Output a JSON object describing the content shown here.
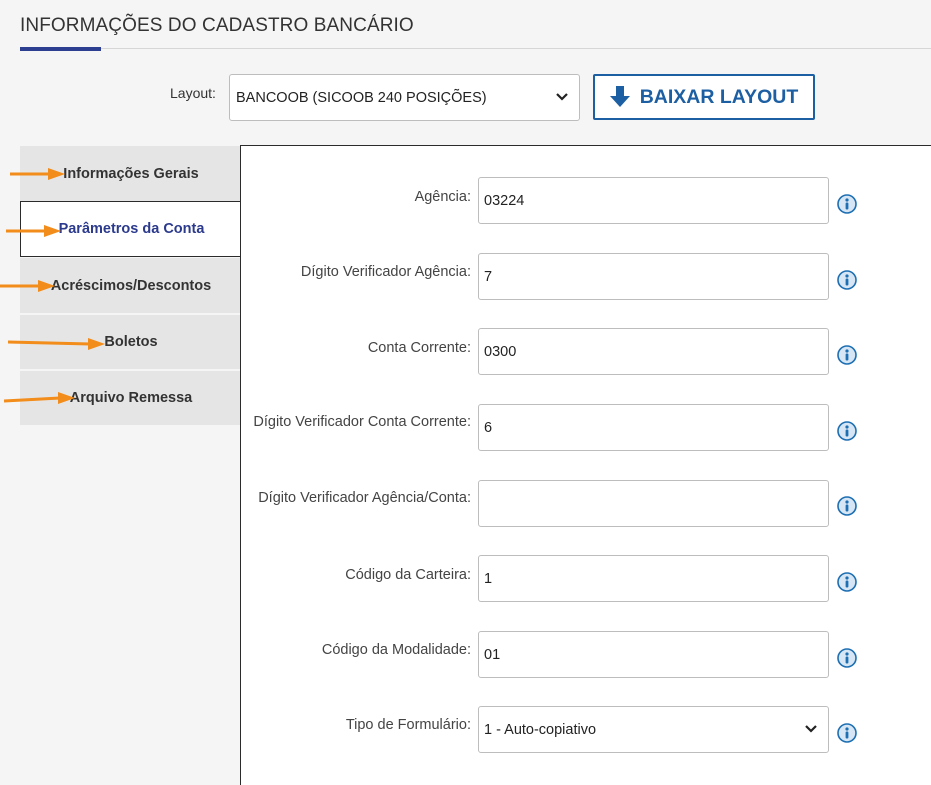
{
  "page": {
    "title": "INFORMAÇÕES DO CADASTRO BANCÁRIO"
  },
  "layout": {
    "label": "Layout:",
    "selected": "BANCOOB (SICOOB 240 POSIÇÕES)",
    "download_label": "BAIXAR LAYOUT"
  },
  "tabs": [
    {
      "label": "Informações Gerais",
      "active": false
    },
    {
      "label": "Parâmetros da Conta",
      "active": true
    },
    {
      "label": "Acréscimos/Descontos",
      "active": false
    },
    {
      "label": "Boletos",
      "active": false
    },
    {
      "label": "Arquivo Remessa",
      "active": false
    }
  ],
  "fields": [
    {
      "label": "Agência:",
      "value": "03224"
    },
    {
      "label": "Dígito Verificador Agência:",
      "value": "7"
    },
    {
      "label": "Conta Corrente:",
      "value": "0300"
    },
    {
      "label": "Dígito Verificador Conta Corrente:",
      "value": "6"
    },
    {
      "label": "Dígito Verificador Agência/Conta:",
      "value": ""
    },
    {
      "label": "Código da Carteira:",
      "value": "1"
    },
    {
      "label": "Código da Modalidade:",
      "value": "01"
    },
    {
      "label": "Tipo de Formulário:",
      "value": "1 - Auto-copiativo"
    }
  ],
  "colors": {
    "accent": "#2c3e8f",
    "button": "#1d5fa3",
    "annotation_arrow": "#f28c1a",
    "info_icon": "#1d6fb3"
  }
}
